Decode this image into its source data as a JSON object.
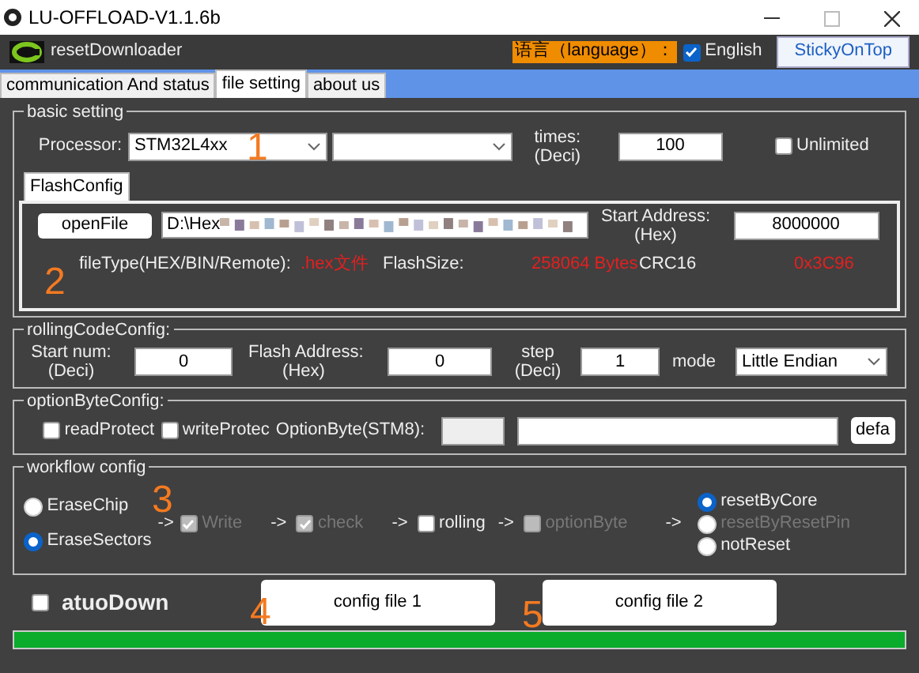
{
  "window": {
    "title": "LU-OFFLOAD-V1.1.6b"
  },
  "header": {
    "app_name": "resetDownloader",
    "language_label": "语言（language）：",
    "english": {
      "label": "English",
      "checked": true
    },
    "sticky_button": "StickyOnTop"
  },
  "tabs": [
    {
      "label": "communication And status",
      "selected": false
    },
    {
      "label": "file setting",
      "selected": true
    },
    {
      "label": "about us",
      "selected": false
    }
  ],
  "basic_setting": {
    "legend": "basic setting",
    "processor_label": "Processor:",
    "processor_value": "STM32L4xx",
    "times_label": "times:",
    "times_unit": "(Deci)",
    "times_value": "100",
    "unlimited": {
      "label": "Unlimited",
      "checked": false
    }
  },
  "flash_config": {
    "tab": "FlashConfig",
    "open_button": "openFile",
    "file_path": "D:\\Hex",
    "start_address_label": "Start Address:",
    "start_address_unit": "(Hex)",
    "start_address_value": "8000000",
    "file_type_label": "fileType(HEX/BIN/Remote):",
    "file_type_value": ".hex文件",
    "flash_size_label": "FlashSize:",
    "flash_size_value": "258064 Bytes",
    "crc_label": "CRC16",
    "crc_value": "0x3C96"
  },
  "rolling_code": {
    "legend": "rollingCodeConfig:",
    "start_label": "Start num:",
    "start_unit": "(Deci)",
    "start_value": "0",
    "address_label": "Flash Address:",
    "address_unit": "(Hex)",
    "address_value": "0",
    "step_label": "step",
    "step_unit": "(Deci)",
    "step_value": "1",
    "mode_label": "mode",
    "mode_value": "Little Endian"
  },
  "option_byte": {
    "legend": "optionByteConfig:",
    "read_protect": {
      "label": "readProtect",
      "checked": false
    },
    "write_protect": {
      "label": "writeProtec",
      "checked": false
    },
    "option_label": "OptionByte(STM8):",
    "default_button": "defa"
  },
  "workflow": {
    "legend": "workflow config",
    "erase_modes": [
      {
        "label": "EraseChip",
        "selected": false
      },
      {
        "label": "EraseSectors",
        "selected": true
      }
    ],
    "steps": [
      {
        "label": "Write",
        "checked": true,
        "disabled": true
      },
      {
        "label": "check",
        "checked": true,
        "disabled": true
      },
      {
        "label": "rolling",
        "checked": false,
        "disabled": false
      },
      {
        "label": "optionByte",
        "checked": false,
        "disabled": true
      }
    ],
    "arrow": "->",
    "reset_modes": [
      {
        "label": "resetByCore",
        "selected": true,
        "disabled": false
      },
      {
        "label": "resetByResetPin",
        "selected": false,
        "disabled": true
      },
      {
        "label": "notReset",
        "selected": false,
        "disabled": false
      }
    ]
  },
  "auto_down": {
    "label": "atuoDown",
    "checked": false
  },
  "config_buttons": [
    "config file 1",
    "config file 2"
  ],
  "progress": {
    "level": 1
  },
  "annotations": [
    "1",
    "2",
    "3",
    "4",
    "5"
  ]
}
